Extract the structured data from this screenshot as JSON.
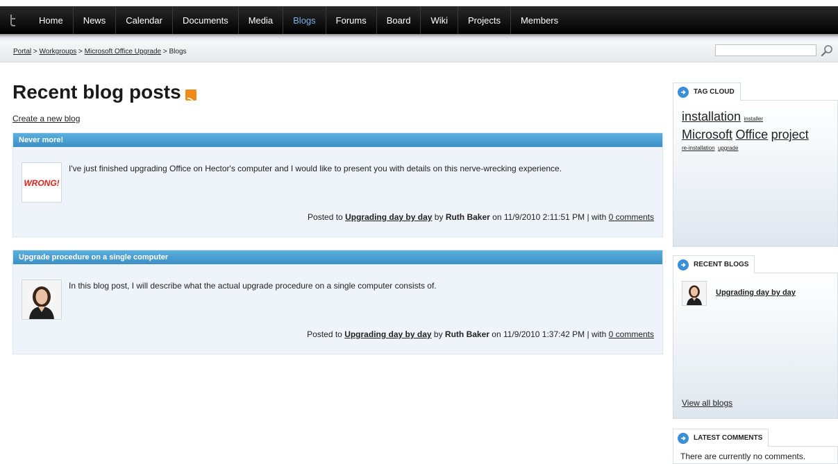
{
  "nav": {
    "items": [
      {
        "label": "Home"
      },
      {
        "label": "News"
      },
      {
        "label": "Calendar"
      },
      {
        "label": "Documents"
      },
      {
        "label": "Media"
      },
      {
        "label": "Blogs"
      },
      {
        "label": "Forums"
      },
      {
        "label": "Board"
      },
      {
        "label": "Wiki"
      },
      {
        "label": "Projects"
      },
      {
        "label": "Members"
      }
    ],
    "active": "Blogs"
  },
  "breadcrumb": {
    "items": [
      {
        "label": "Portal"
      },
      {
        "label": "Workgroups"
      },
      {
        "label": "Microsoft Office Upgrade"
      }
    ],
    "separator": " > ",
    "current": "Blogs"
  },
  "search": {
    "placeholder": "",
    "value": ""
  },
  "page": {
    "title": "Recent blog posts",
    "create_link": "Create a new blog"
  },
  "posts": [
    {
      "title": "Never more!",
      "summary": "I've just finished upgrading Office on Hector's computer and I would like to present you with details on this nerve-wrecking experience.",
      "thumb_text": "WRONG!",
      "posted_to_prefix": "Posted to",
      "blog": "Upgrading day by day",
      "by": "by",
      "author": "Ruth Baker",
      "date_text": "on 11/9/2010 2:11:51 PM | with",
      "comments": "0 comments"
    },
    {
      "title": "Upgrade procedure on a single computer",
      "summary": "In this blog post, I will describe what the actual upgrade procedure on a single computer consists of.",
      "thumb_text": "",
      "posted_to_prefix": "Posted to",
      "blog": "Upgrading day by day",
      "by": "by",
      "author": "Ruth Baker",
      "date_text": "on 11/9/2010 1:37:42 PM | with",
      "comments": "0 comments"
    }
  ],
  "sidebar": {
    "tag_cloud": {
      "title": "TAG CLOUD",
      "tags": [
        "installation",
        "installer",
        "Microsoft",
        "Office",
        "project",
        "re-installation",
        "upgrade"
      ]
    },
    "recent_blogs": {
      "title": "RECENT BLOGS",
      "items": [
        {
          "label": "Upgrading day by day"
        }
      ],
      "view_all": "View all blogs"
    },
    "latest_comments": {
      "title": "LATEST COMMENTS",
      "empty_text": "There are currently no comments."
    }
  },
  "colors": {
    "header_blue": "#3d8fc4",
    "active_nav": "#7fb0e6",
    "rss": "#f28a1a"
  }
}
